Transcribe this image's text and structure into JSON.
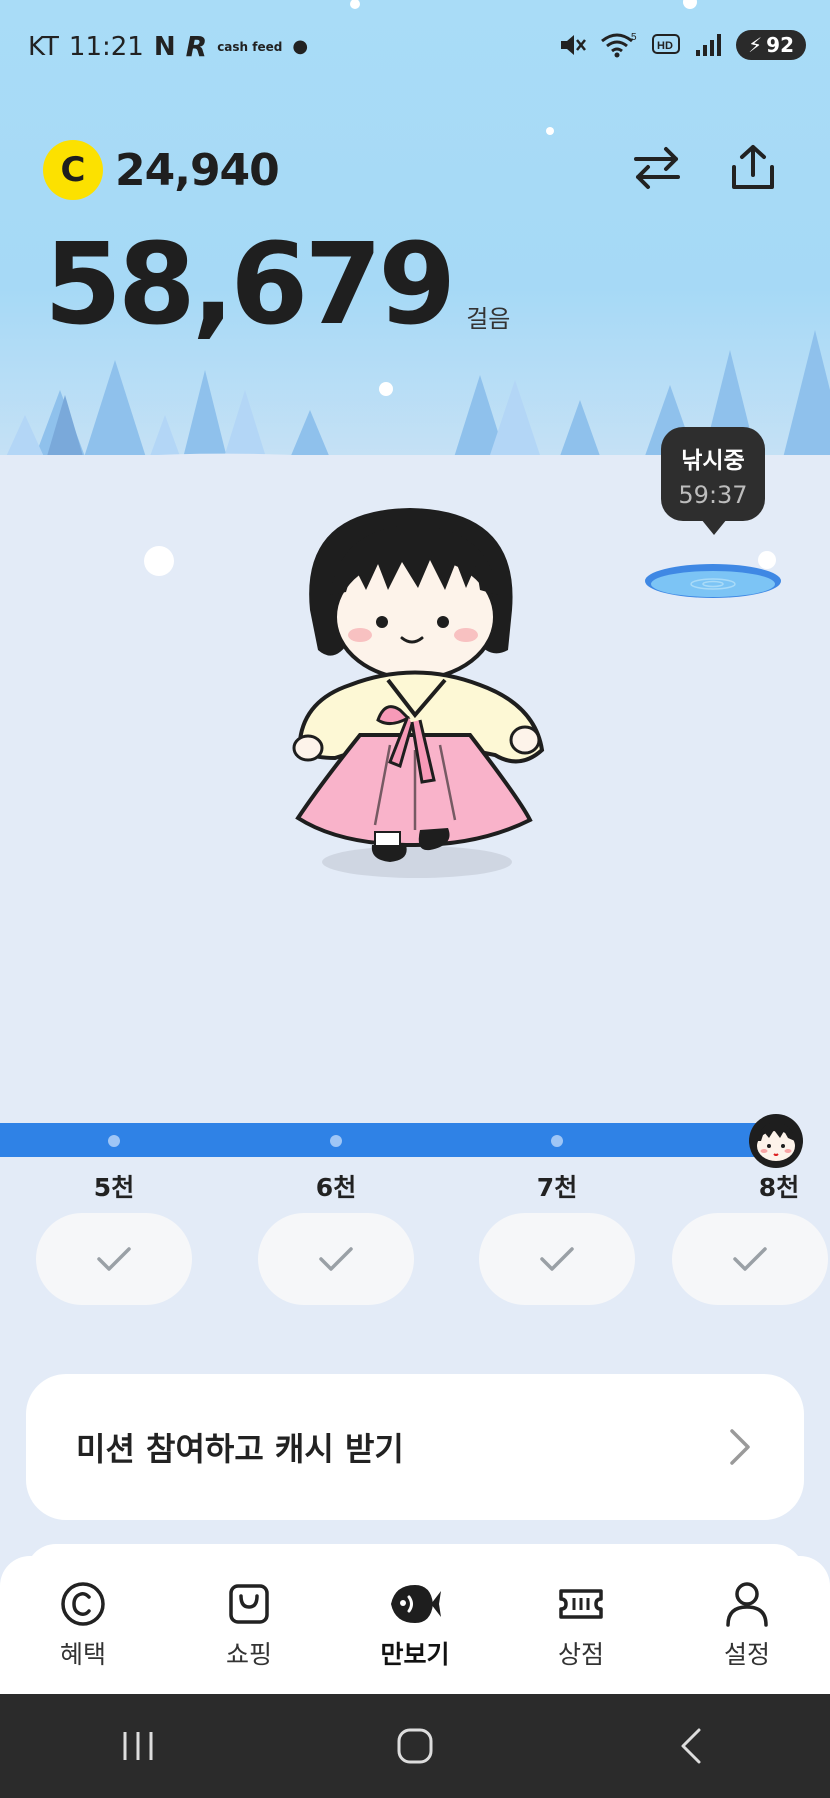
{
  "status_bar": {
    "carrier": "KT",
    "time": "11:21",
    "app_icons": [
      "N",
      "R",
      "cash feed"
    ],
    "battery_level": "92",
    "icons": [
      "mute-icon",
      "wifi-icon",
      "hd-icon",
      "signal-icon",
      "battery-icon"
    ]
  },
  "header": {
    "coin_symbol": "C",
    "coin_amount": "24,940",
    "steps": "58,679",
    "steps_unit": "걸음",
    "icons": [
      "exchange-icon",
      "share-icon"
    ]
  },
  "fishing": {
    "title": "낚시중",
    "timer": "59:37"
  },
  "progress": {
    "fraction": 1.0,
    "milestones": [
      {
        "label": "5천",
        "done": true
      },
      {
        "label": "6천",
        "done": true
      },
      {
        "label": "7천",
        "done": true
      },
      {
        "label": "8천",
        "done": true
      }
    ]
  },
  "mission": {
    "label": "미션 참여하고 캐시 받기"
  },
  "bottom_nav": {
    "items": [
      {
        "label": "혜택",
        "icon": "copyright-coin-icon",
        "active": false
      },
      {
        "label": "쇼핑",
        "icon": "shopping-bag-icon",
        "active": false
      },
      {
        "label": "만보기",
        "icon": "fish-icon",
        "active": true
      },
      {
        "label": "상점",
        "icon": "ticket-icon",
        "active": false
      },
      {
        "label": "설정",
        "icon": "person-icon",
        "active": false
      }
    ]
  },
  "colors": {
    "sky": "#a6d9f6",
    "field": "#e3ebf7",
    "progress": "#2f82e6",
    "coin": "#fce100"
  }
}
